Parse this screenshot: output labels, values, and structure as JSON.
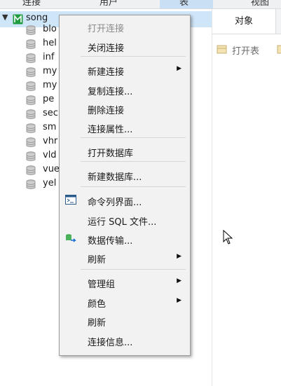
{
  "toolbar": {
    "items": [
      "连接",
      "用户",
      "表",
      "视图"
    ]
  },
  "tree": {
    "connection": {
      "name": "song"
    },
    "databases": [
      "blo",
      "hel",
      "inf",
      "my",
      "my",
      "pe",
      "sec",
      "sm",
      "vhr",
      "vld",
      "vue",
      "yel"
    ]
  },
  "right_pane": {
    "tab_label": "对象",
    "open_table_label": "打开表"
  },
  "context_menu": {
    "items": [
      {
        "label": "打开连接",
        "disabled": true
      },
      {
        "label": "关闭连接"
      },
      {
        "label": "新建连接",
        "submenu": true
      },
      {
        "label": "复制连接..."
      },
      {
        "label": "删除连接"
      },
      {
        "label": "连接属性..."
      },
      {
        "label": "打开数据库"
      },
      {
        "label": "新建数据库..."
      },
      {
        "label": "命令列界面...",
        "icon": "console-icon"
      },
      {
        "label": "运行 SQL 文件..."
      },
      {
        "label": "数据传输...",
        "icon": "data-transfer-icon"
      },
      {
        "label": "刷新",
        "submenu": true
      },
      {
        "label": "管理组",
        "submenu": true
      },
      {
        "label": "颜色",
        "submenu": true
      },
      {
        "label": "刷新"
      },
      {
        "label": "连接信息..."
      }
    ]
  },
  "colors": {
    "selection": "#cfe5f8",
    "menu_background": "#f2f2f2",
    "menu_border": "#9c9c9c",
    "connection_icon": "#1e9c3f"
  }
}
